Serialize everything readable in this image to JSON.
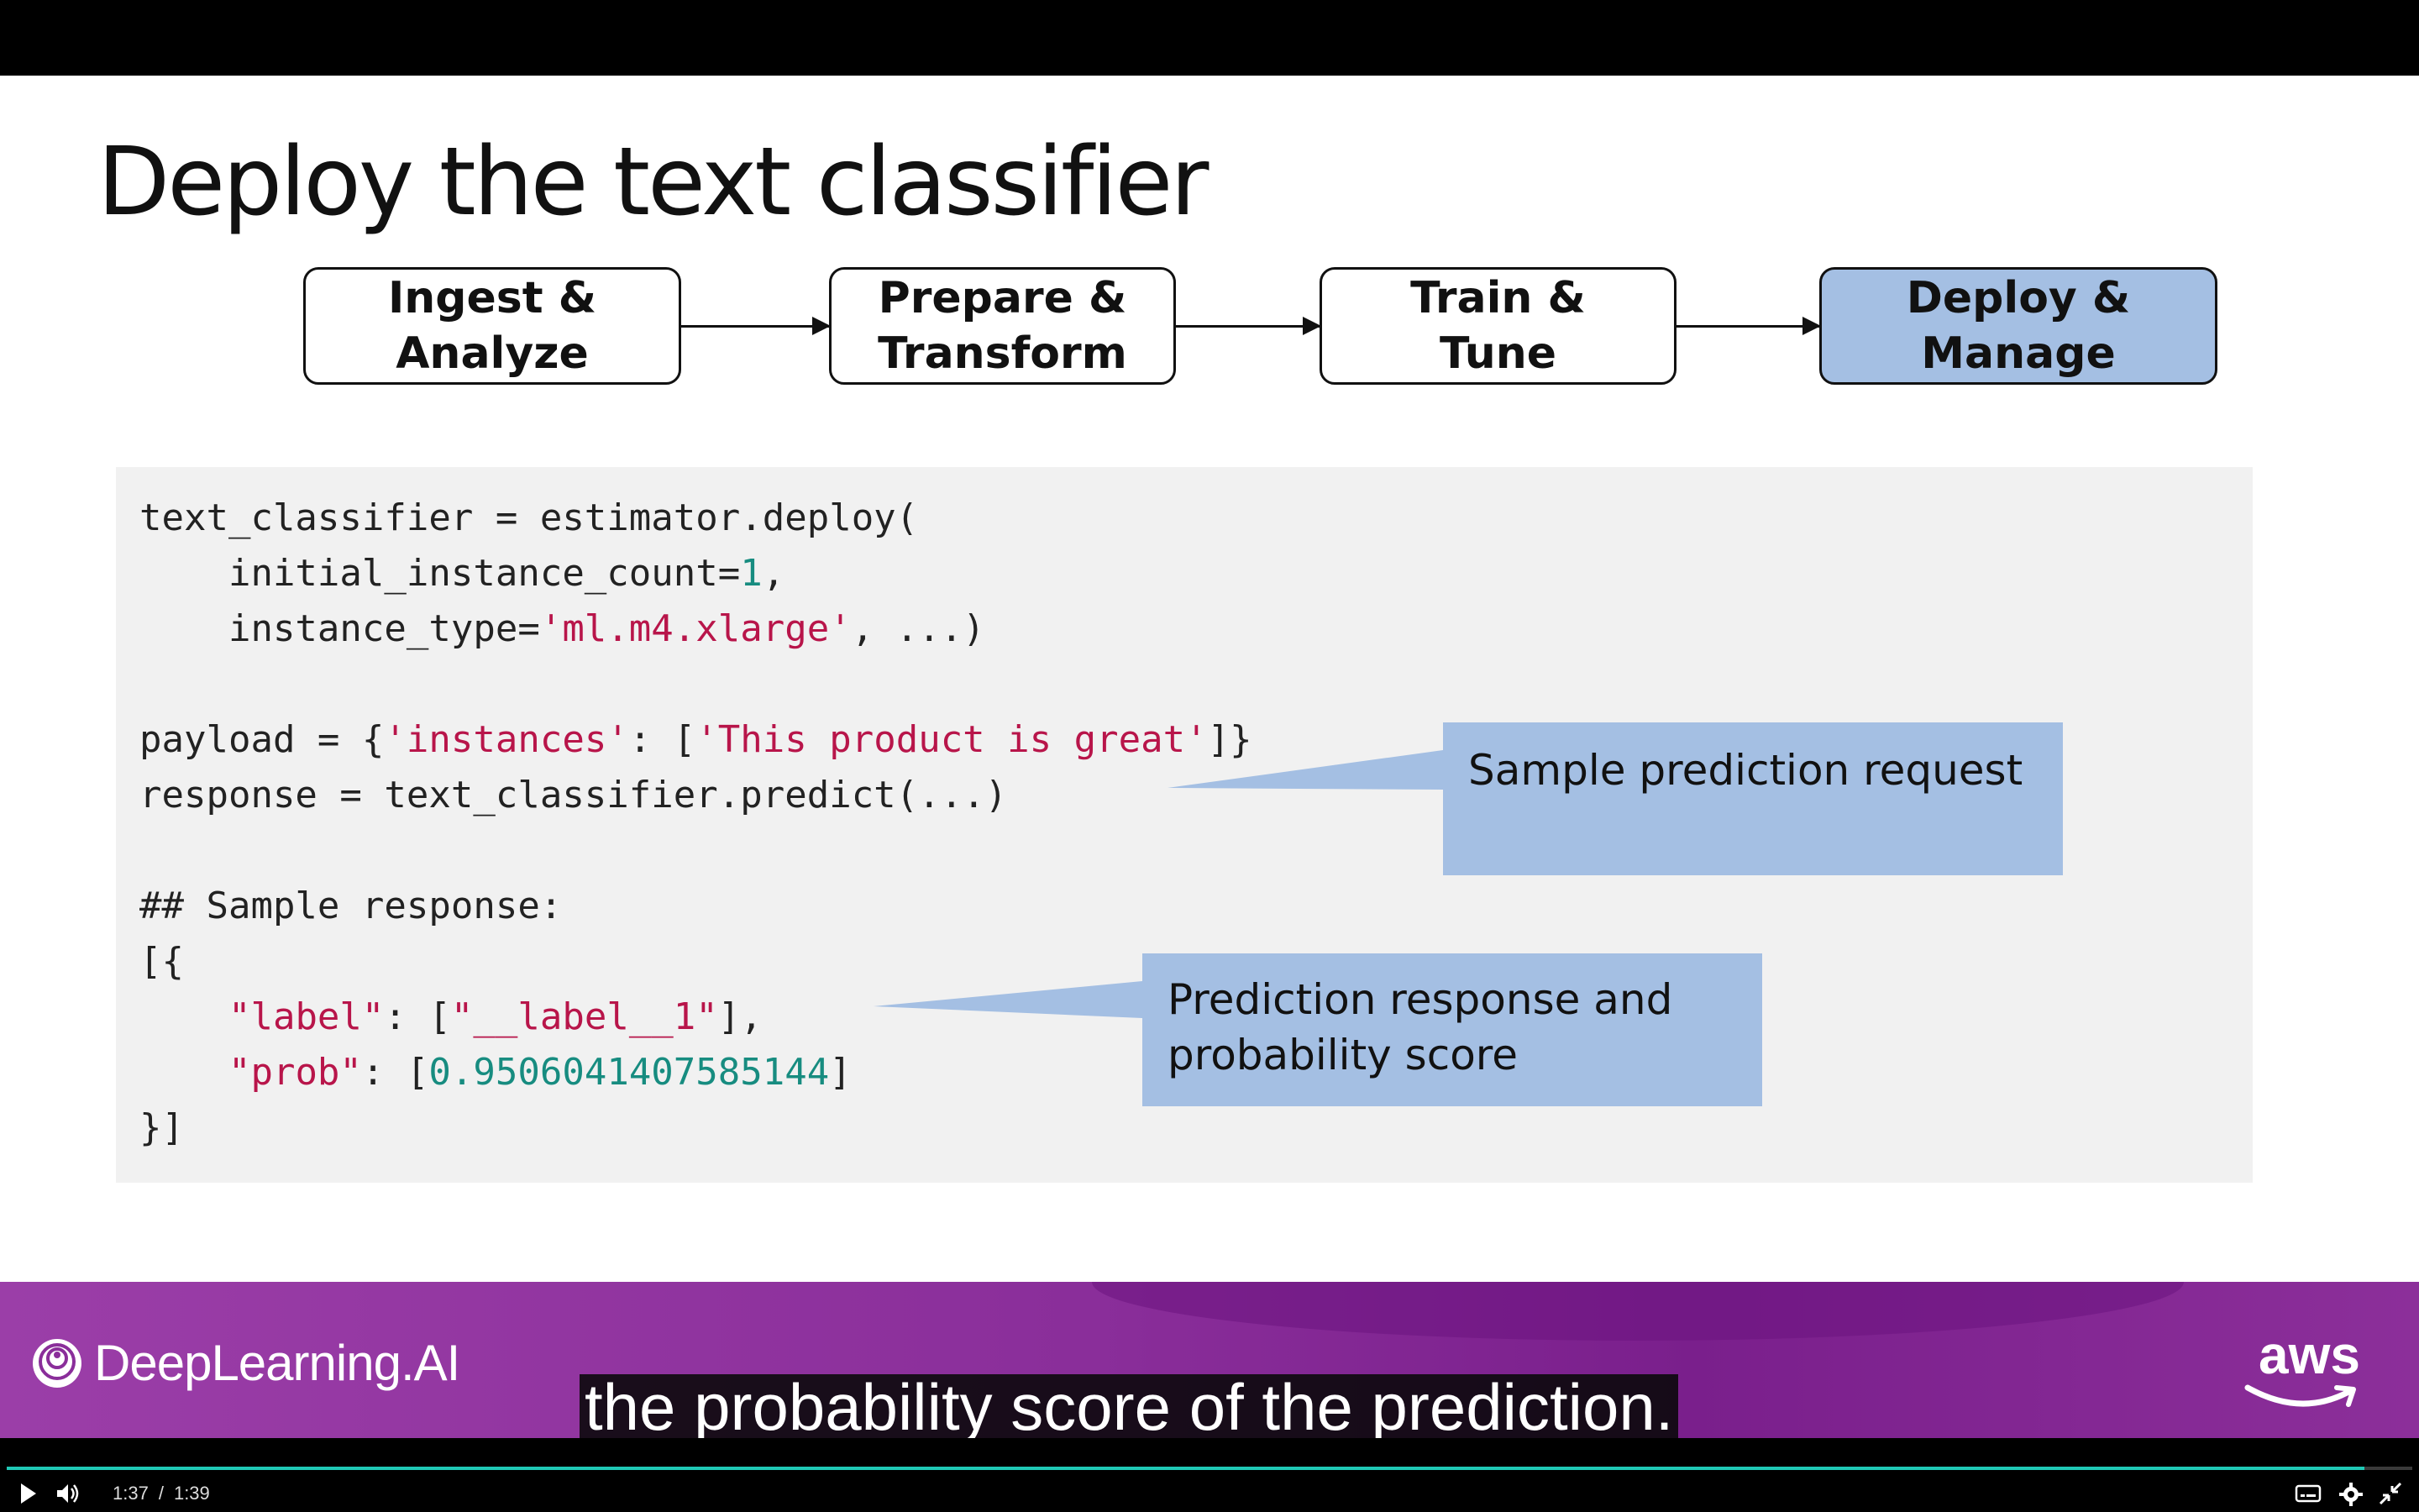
{
  "slide": {
    "title": "Deploy the text classifier",
    "pipeline": [
      {
        "label": "Ingest &\nAnalyze",
        "active": false
      },
      {
        "label": "Prepare &\nTransform",
        "active": false
      },
      {
        "label": "Train &\nTune",
        "active": false
      },
      {
        "label": "Deploy &\nManage",
        "active": true
      }
    ],
    "code": {
      "l1": "text_classifier = estimator.deploy(",
      "l2_a": "    initial_instance_count=",
      "l2_num": "1",
      "l2_b": ",",
      "l3_a": "    instance_type=",
      "l3_str": "'ml.m4.xlarge'",
      "l3_b": ", ...)",
      "l5_a": "payload = {",
      "l5_str1": "'instances'",
      "l5_b": ": [",
      "l5_str2": "'This product is great'",
      "l5_c": "]}",
      "l6": "response = text_classifier.predict(...)",
      "l8": "## Sample response:",
      "l9": "[{",
      "l10_a": "    ",
      "l10_str1": "\"label\"",
      "l10_b": ": [",
      "l10_str2": "\"__label__1\"",
      "l10_c": "],",
      "l11_a": "    ",
      "l11_str": "\"prob\"",
      "l11_b": ": [",
      "l11_num": "0.9506041407585144",
      "l11_c": "]",
      "l12": "}]"
    },
    "callouts": {
      "request": "Sample prediction request",
      "response": "Prediction response and\nprobability score"
    },
    "colors": {
      "highlight": "#a4bfe3",
      "string": "#b8154a",
      "number": "#178c80"
    }
  },
  "banner": {
    "brand": "DeepLearning.AI",
    "partner": "aws"
  },
  "caption": "the probability score of the prediction.",
  "player": {
    "current_time": "1:37",
    "separator": "/",
    "duration": "1:39",
    "progress": 0.98,
    "icons": [
      "play-icon",
      "volume-icon",
      "captions-icon",
      "settings-icon",
      "fullscreen-exit-icon"
    ]
  }
}
